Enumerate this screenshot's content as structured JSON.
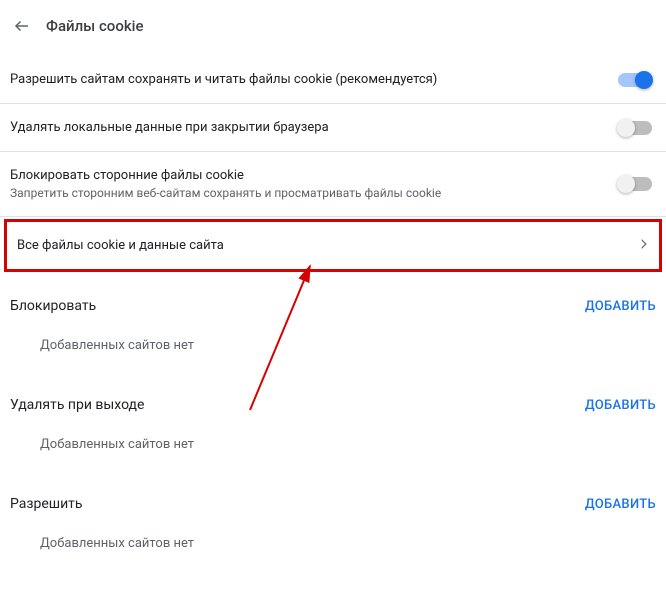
{
  "header": {
    "title": "Файлы cookie"
  },
  "settings": {
    "allowCookies": {
      "label": "Разрешить сайтам сохранять и читать файлы cookie (рекомендуется)",
      "enabled": true
    },
    "clearOnExit": {
      "label": "Удалять локальные данные при закрытии браузера",
      "enabled": false
    },
    "blockThirdParty": {
      "label": "Блокировать сторонние файлы cookie",
      "sub": "Запретить сторонним веб-сайтам сохранять и просматривать файлы cookie",
      "enabled": false
    },
    "allDataLink": {
      "label": "Все файлы cookie и данные сайта"
    }
  },
  "sections": {
    "block": {
      "title": "Блокировать",
      "addLabel": "ДОБАВИТЬ",
      "emptyMsg": "Добавленных сайтов нет"
    },
    "clearOnExit": {
      "title": "Удалять при выходе",
      "addLabel": "ДОБАВИТЬ",
      "emptyMsg": "Добавленных сайтов нет"
    },
    "allow": {
      "title": "Разрешить",
      "addLabel": "ДОБАВИТЬ",
      "emptyMsg": "Добавленных сайтов нет"
    }
  }
}
